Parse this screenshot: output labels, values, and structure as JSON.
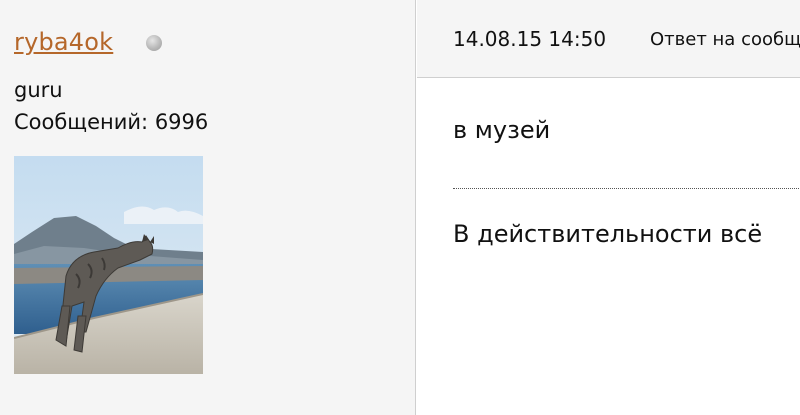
{
  "author": {
    "username": "ryba4ok",
    "status": "offline",
    "rank": "guru",
    "posts_label": "Сообщений:",
    "posts_count": "6996",
    "avatar_icon": "cat-on-seawall-avatar"
  },
  "post": {
    "date": "14.08.15 14:50",
    "reply_label": "Ответ на сообщение",
    "quote": "в музей",
    "text": "В действительности всё"
  },
  "colors": {
    "username": "#b5672a",
    "panel_bg": "#f5f5f5",
    "border": "#cfcfcf"
  }
}
